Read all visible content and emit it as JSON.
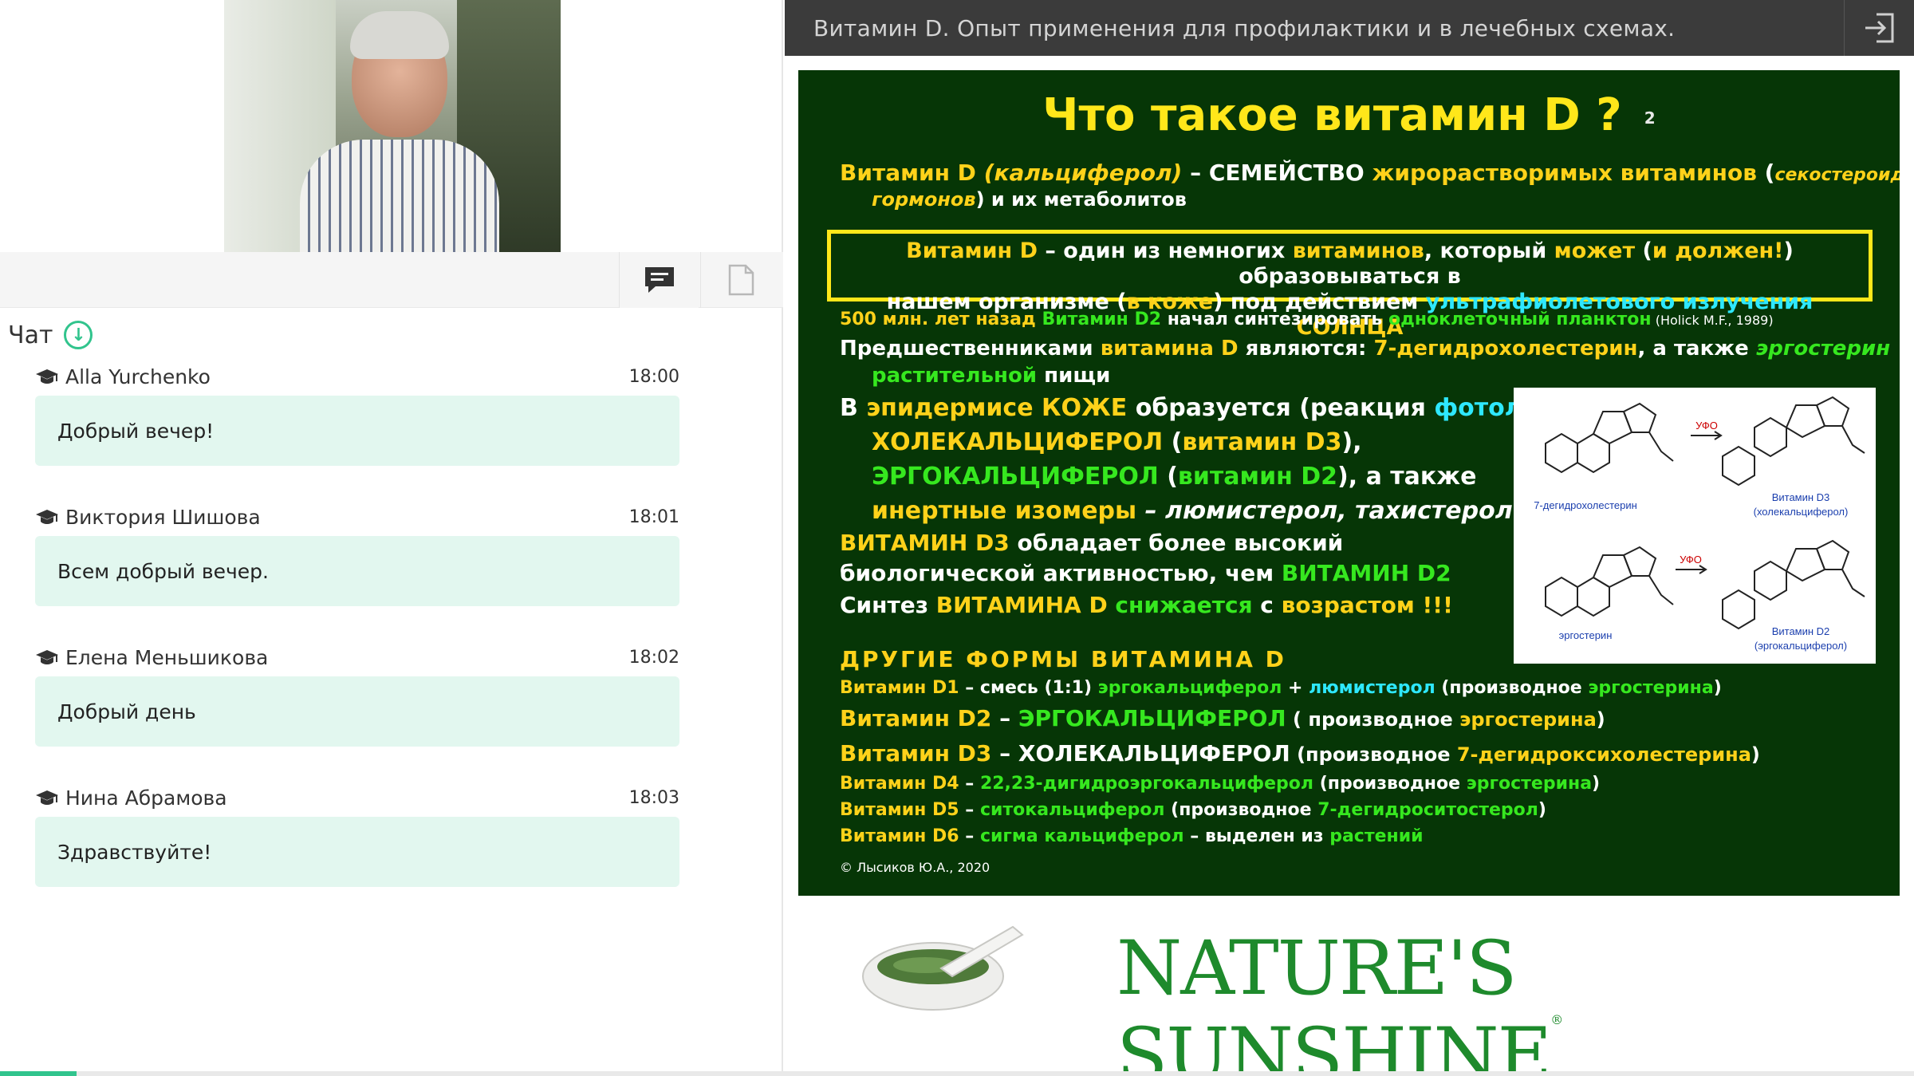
{
  "app": {
    "title": "Витамин D. Опыт применения для профилактики и в лечебных схемах.",
    "accent": "#31c48d",
    "progress": 0.04
  },
  "left": {
    "chat_tab_icon": "chat-bubble-icon",
    "files_tab_icon": "document-icon",
    "chat_title": "Чат",
    "messages": [
      {
        "author": "Alla Yurchenko",
        "time": "18:00",
        "text": "Добрый вечер!"
      },
      {
        "author": "Виктория Шишова",
        "time": "18:01",
        "text": "Всем добрый вечер."
      },
      {
        "author": "Елена Меньшикова",
        "time": "18:02",
        "text": "Добрый день"
      },
      {
        "author": "Нина Абрамова",
        "time": "18:03",
        "text": "Здравствуйте!"
      }
    ]
  },
  "slide": {
    "title": "Что такое витамин D ?",
    "page_num": "2",
    "l1a": "Витамин D",
    "l1b": "(кальциферол)",
    "l1c": " – СЕМЕЙСТВО ",
    "l1d": "жирорастворимых",
    "l1e": " витаминов",
    "l1f": " (",
    "l1g": "секостероидных",
    "l2a": "гормонов",
    "l2b": ") и их метаболитов",
    "box1a": "Витамин D",
    "box1b": " – один из немногих ",
    "box1c": "витаминов",
    "box1d": ", который ",
    "box1e": "может",
    "box1f": " (",
    "box1g": "и должен!",
    "box1h": ") образовываться в",
    "box2a": "нашем организме (",
    "box2b": "в коже",
    "box2c": ") под действием ",
    "box2d": "ультрафиолетового излучения",
    "box2e": " СОЛНЦА",
    "l3a": "500 млн. лет назад ",
    "l3b": "Витамин D2",
    "l3c": " начал синтезировать ",
    "l3d": "одноклеточный планктон",
    "l3e": " (Holick M.F., 1989)",
    "l4a": "Предшественниками ",
    "l4b": "витамина D",
    "l4c": " являются: ",
    "l4d": "7-дегидрохолестерин",
    "l4e": ", а также ",
    "l4f": "эргостерин",
    "l5a": "растительной",
    "l5b": " пищи",
    "l6a": "В ",
    "l6b": "эпидермисе КОЖЕ",
    "l6c": " образуется (реакция ",
    "l6d": "фотолиза",
    "l6e": "):",
    "l7a": "ХОЛЕКАЛЬЦИФЕРОЛ",
    "l7b": " (",
    "l7c": "витамин D3",
    "l7d": "),",
    "l8a": "ЭРГОКАЛЬЦИФЕРОЛ",
    "l8b": " (",
    "l8c": "витамин D2",
    "l8d": "), а также",
    "l9a": "инертные изомеры",
    "l9b": " – люмистерол, тахистерол",
    "l10a": "ВИТАМИН D3",
    "l10b": " обладает более высокий",
    "l11a": "биологической активностью, чем ",
    "l11b": "ВИТАМИН D2",
    "l12a": "Синтез ",
    "l12b": "ВИТАМИНА D",
    "l12c": " снижается",
    "l12d": " с ",
    "l12e": "возрастом",
    "l12f": " !!!",
    "l13": "ДРУГИЕ ФОРМЫ ВИТАМИНА D",
    "l14a": "Витамин D1",
    "l14b": " – смесь (1:1) ",
    "l14c": "эргокальциферол",
    "l14d": " + ",
    "l14e": "люмистерол",
    "l14f": " (производное ",
    "l14g": "эргостерина",
    "l14h": ")",
    "l15a": "Витамин D2",
    "l15b": " – ",
    "l15c": "ЭРГОКАЛЬЦИФЕРОЛ",
    "l15d": " ( производное ",
    "l15e": "эргостерина",
    "l15f": ")",
    "l16a": "Витамин D3",
    "l16b": " – ",
    "l16c": "ХОЛЕКАЛЬЦИФЕРОЛ",
    "l16d": " (производное ",
    "l16e": "7-дегидроксихолестерина",
    "l16f": ")",
    "l17a": "Витамин D4",
    "l17b": " – ",
    "l17c": "22,23-дигидроэргокальциферол",
    "l17d": " (производное ",
    "l17e": "эргостерина",
    "l17f": ")",
    "l18a": "Витамин D5",
    "l18b": " – ",
    "l18c": "ситокальциферол",
    "l18d": " (производное ",
    "l18e": "7-дегидроситостерол",
    "l18f": ")",
    "l19a": "Витамин D6",
    "l19b": " – ",
    "l19c": "сигма кальциферол",
    "l19d": " – выделен из ",
    "l19e": "растений",
    "chem_labels": {
      "a": "7-дегидрохолестерин",
      "b": "Витамин D3",
      "b2": "(холекальциферол)",
      "c": "эргостерин",
      "d": "Витамин D2",
      "d2": "(эргокальциферол)",
      "uv": "УФО"
    },
    "copyright": "© Лысиков Ю.А., 2020"
  },
  "footer": {
    "brand": "NATURE'S SUNSHINE",
    "reg": "®",
    "brand_color": "#1e8a2c"
  }
}
